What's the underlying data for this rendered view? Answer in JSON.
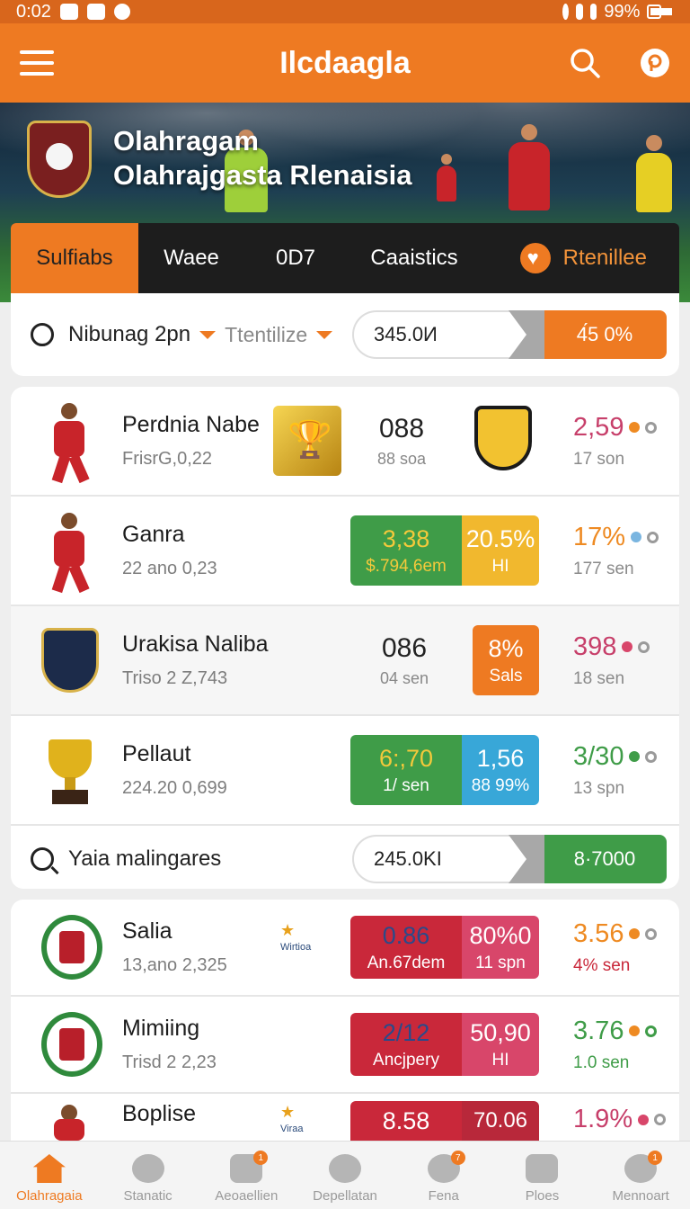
{
  "status_bar": {
    "time": "0:02",
    "battery": "99%"
  },
  "header": {
    "title": "Ilcdaagla"
  },
  "hero": {
    "line1": "Olahragam",
    "line2": "Olahrajgasta Rlenaisia"
  },
  "tabs": [
    {
      "label": "Sulfiabs",
      "active": true
    },
    {
      "label": "Waee"
    },
    {
      "label": "0D7"
    },
    {
      "label": "Caaistics"
    },
    {
      "label": "Rtenillee"
    }
  ],
  "filter": {
    "label": "Nibunag 2pn",
    "select": "Ttentilize",
    "value_left": "345.0И",
    "value_right": "4́5 0%"
  },
  "rows": [
    {
      "name": "Perdnia Nabe",
      "sub": "FrisrG,0,22",
      "mid_big": "088",
      "mid_small": "88 soa",
      "right_big": "2,59",
      "right_small": "17 son",
      "color": "#c73f6a"
    },
    {
      "name": "Ganra",
      "sub": "22 ano 0,23",
      "block1_big": "3,38",
      "block1_small": "$.794,6em",
      "block2_big": "20.5%",
      "block2_small": "HI",
      "right_big": "17%",
      "right_small": "177 sen",
      "color": "#ee8a22"
    },
    {
      "name": "Urakisa Naliba",
      "sub": "Triso 2 Z,743",
      "mid_big": "086",
      "mid_small": "04 sen",
      "block_big": "8%",
      "block_small": "Sals",
      "right_big": "398",
      "right_small": "18 sen",
      "color": "#c73f6a"
    },
    {
      "name": "Pellaut",
      "sub": "224.20 0,699",
      "block1_big": "6:,70",
      "block1_small": "1/ sen",
      "block2_big": "1,56",
      "block2_small": "88 99%",
      "right_big": "3/30",
      "right_small": "13 spn",
      "color": "#3f9c48"
    }
  ],
  "search": {
    "label": "Yaia malingares",
    "value_left": "245.0KI",
    "value_right": "8·7000"
  },
  "rows2": [
    {
      "name": "Salia",
      "sub": "13,ano 2,325",
      "star_label": "Wirtioa",
      "block1_big": "0.86",
      "block1_small": "An.67dem",
      "block2_big": "80%0",
      "block2_small": "11 spn",
      "right_big": "3.56",
      "right_small": "4% sen",
      "color": "#ee8a22"
    },
    {
      "name": "Mimiing",
      "sub": "Trisd 2 2,23",
      "block1_big": "2/12",
      "block1_small": "Ancjpery",
      "block2_big": "50,90",
      "block2_small": "HI",
      "right_big": "3.76",
      "right_small": "1.0 sen",
      "color": "#3f9c48"
    },
    {
      "name": "Boplise",
      "star_label": "Viraa",
      "block1_big": "8.58",
      "block2_big": "70.06",
      "right_big": "1.9%",
      "color": "#c73f6a"
    }
  ],
  "bottom_nav": [
    {
      "label": "Olahragaia",
      "active": true
    },
    {
      "label": "Stanatic"
    },
    {
      "label": "Aeoaellien",
      "badge": "1"
    },
    {
      "label": "Depellatan"
    },
    {
      "label": "Fena",
      "badge": "7"
    },
    {
      "label": "Ploes"
    },
    {
      "label": "Mennoart",
      "badge": "1"
    }
  ]
}
